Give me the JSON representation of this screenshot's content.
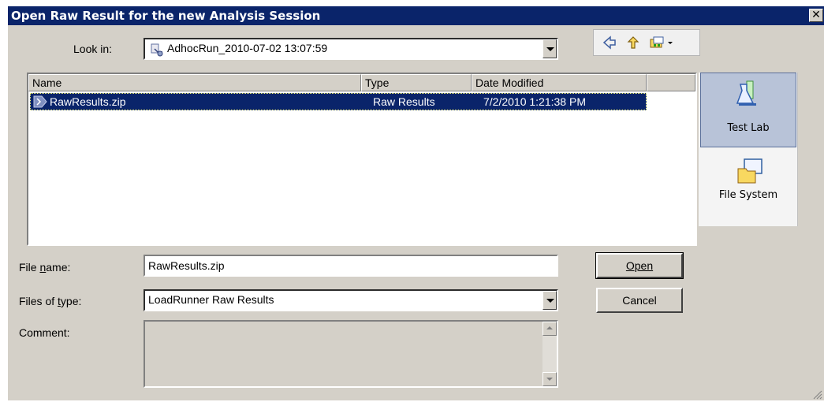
{
  "window": {
    "title": "Open Raw Result for the new Analysis Session",
    "close_symbol": "✕"
  },
  "look_in": {
    "label": "Look in:",
    "value": "AdhocRun_2010-07-02 13:07:59",
    "icon": "folder-run-icon"
  },
  "toolbar": {
    "icons": [
      "back-icon",
      "up-folder-icon",
      "view-menu-icon"
    ]
  },
  "file_list": {
    "columns": [
      "Name",
      "Type",
      "Date Modified"
    ],
    "rows": [
      {
        "name": "RawResults.zip",
        "type": "Raw Results",
        "date_modified": "7/2/2010 1:21:38 PM",
        "selected": true
      }
    ]
  },
  "places": [
    {
      "label": "Test Lab",
      "icon": "test-lab-flask-icon",
      "selected": true
    },
    {
      "label": "File System",
      "icon": "file-system-icon",
      "selected": false
    }
  ],
  "file_name": {
    "label": "File name:",
    "value": "RawResults.zip"
  },
  "files_of_type": {
    "label": "Files of type:",
    "value": "LoadRunner Raw Results"
  },
  "comment": {
    "label": "Comment:",
    "value": ""
  },
  "buttons": {
    "open": "Open",
    "cancel": "Cancel"
  },
  "colors": {
    "title_bar": "#0a246a",
    "selection": "#0a246a",
    "dialog_bg": "#d4d0c8"
  }
}
